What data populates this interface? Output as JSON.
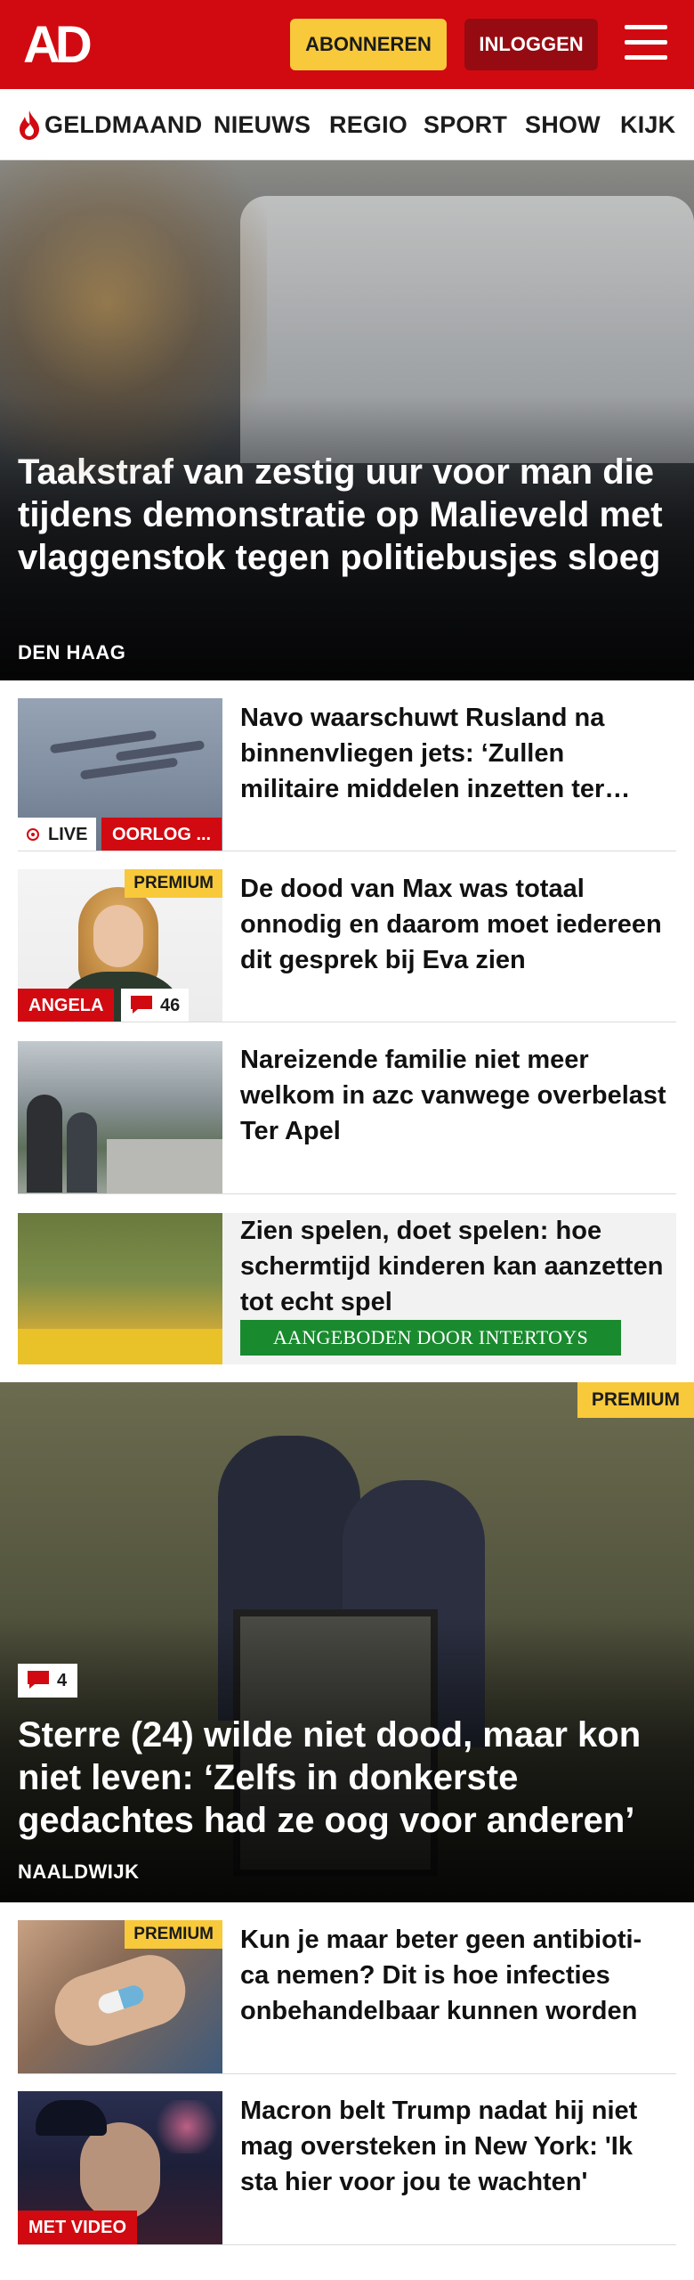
{
  "header": {
    "logo_text": "AD",
    "subscribe_label": "ABONNEREN",
    "login_label": "INLOGGEN",
    "menu_icon": "hamburger-menu-icon",
    "brand_color": "#d10a11"
  },
  "nav": {
    "items": [
      {
        "label": "GELDMAAND",
        "icon": "flame-icon"
      },
      {
        "label": "NIEUWS"
      },
      {
        "label": "REGIO"
      },
      {
        "label": "SPORT"
      },
      {
        "label": "SHOW"
      },
      {
        "label": "KIJK"
      }
    ]
  },
  "hero": {
    "title": "Taakstraf van zestig uur voor man die tijdens demonstratie op Malieveld met vlaggenstok tegen politiebusjes sloeg",
    "location": "DEN HAAG"
  },
  "articles": [
    {
      "title": "Navo waarschuwt Rusland na binnenvliegen jets: ‘Zullen militaire middelen inzetten ter verdediging’",
      "live_label": "LIVE",
      "tag": "OORLOG ..."
    },
    {
      "title": "De dood van Max was totaal onnodig en daarom moet iedereen dit gesprek bij Eva zien",
      "premium_label": "PREMIUM",
      "tag": "ANGELA",
      "comments": "46"
    },
    {
      "title": "Nareizende familie niet meer welkom in azc vanwege overbelast Ter Apel"
    },
    {
      "title": "Zien spelen, doet spelen: hoe schermtijd kinderen kan aanzetten tot echt spel",
      "sponsored_label": "AANGEBODEN DOOR INTERTOYS",
      "sponsored_color": "#1a8a2f"
    }
  ],
  "feature": {
    "premium_label": "PREMIUM",
    "comments": "4",
    "title": "Sterre (24) wilde niet dood, maar kon niet leven: ‘Zelfs in donkerste gedachtes had ze oog voor anderen’",
    "location": "NAALDWIJK"
  },
  "articles2": [
    {
      "title": "Kun je maar beter geen antibioti-ca nemen? Dit is hoe infecties onbehandelbaar kunnen worden",
      "premium_label": "PREMIUM"
    },
    {
      "title": "Macron belt Trump nadat hij niet mag oversteken in New York: 'Ik sta hier voor jou te wachten'",
      "tag": "MET VIDEO"
    }
  ],
  "colors": {
    "premium_yellow": "#f8c93a",
    "separator": "#dadada"
  }
}
